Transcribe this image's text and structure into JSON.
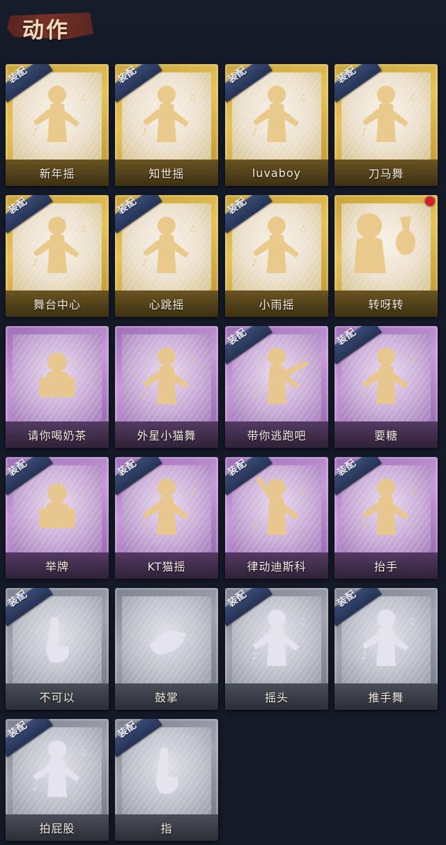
{
  "section_title": "动作",
  "equip_tag": "装配",
  "colors": {
    "gold": "#e6c35b",
    "purple": "#c79bd9",
    "gray": "#a3a6b1",
    "tag_blue": "#2b3a62",
    "new_dot": "#d3202a"
  },
  "cards": [
    {
      "label": "新年摇",
      "rarity": "gold",
      "equipped": true,
      "icon": "dance-pose-icon"
    },
    {
      "label": "知世摇",
      "rarity": "gold",
      "equipped": true,
      "icon": "dance-pose-icon"
    },
    {
      "label": "luvaboy",
      "rarity": "gold",
      "equipped": true,
      "icon": "dance-pose-icon"
    },
    {
      "label": "刀马舞",
      "rarity": "gold",
      "equipped": true,
      "icon": "dance-pose-icon"
    },
    {
      "label": "舞台中心",
      "rarity": "gold",
      "equipped": true,
      "icon": "dance-pose-icon"
    },
    {
      "label": "心跳摇",
      "rarity": "gold",
      "equipped": true,
      "icon": "dance-pose-icon"
    },
    {
      "label": "小雨摇",
      "rarity": "gold",
      "equipped": true,
      "icon": "dance-pose-icon"
    },
    {
      "label": "转呀转",
      "rarity": "gold",
      "equipped": false,
      "new": true,
      "icon": "girl-with-rabbit-icon"
    },
    {
      "label": "请你喝奶茶",
      "rarity": "purple",
      "equipped": false,
      "icon": "sign-holding-icon"
    },
    {
      "label": "外星小猫舞",
      "rarity": "purple",
      "equipped": false,
      "icon": "dance-pose-icon"
    },
    {
      "label": "带你逃跑吧",
      "rarity": "purple",
      "equipped": true,
      "icon": "pointing-pose-icon"
    },
    {
      "label": "要糖",
      "rarity": "purple",
      "equipped": true,
      "icon": "reaching-hand-icon"
    },
    {
      "label": "举牌",
      "rarity": "purple",
      "equipped": true,
      "icon": "sign-holding-icon"
    },
    {
      "label": "KT猫摇",
      "rarity": "purple",
      "equipped": true,
      "icon": "dance-pose-icon"
    },
    {
      "label": "律动迪斯科",
      "rarity": "purple",
      "equipped": true,
      "icon": "disco-pose-icon"
    },
    {
      "label": "抬手",
      "rarity": "purple",
      "equipped": true,
      "icon": "raise-hand-icon"
    },
    {
      "label": "不可以",
      "rarity": "gray",
      "equipped": true,
      "icon": "wagging-finger-icon"
    },
    {
      "label": "鼓掌",
      "rarity": "gray",
      "equipped": false,
      "icon": "clapping-hands-icon"
    },
    {
      "label": "摇头",
      "rarity": "gray",
      "equipped": true,
      "icon": "head-shake-icon"
    },
    {
      "label": "推手舞",
      "rarity": "gray",
      "equipped": true,
      "icon": "push-dance-icon"
    },
    {
      "label": "拍屁股",
      "rarity": "gray",
      "equipped": true,
      "icon": "butt-slap-icon"
    },
    {
      "label": "指",
      "rarity": "gray",
      "equipped": true,
      "icon": "pointing-hand-icon"
    }
  ]
}
